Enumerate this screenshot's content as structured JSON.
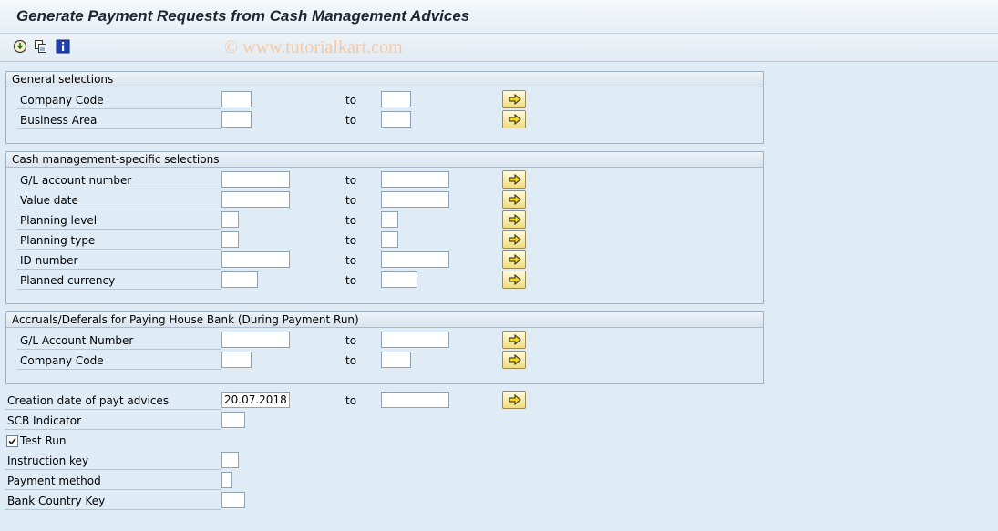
{
  "header": {
    "title": "Generate Payment Requests from Cash Management Advices"
  },
  "toolbar": {
    "execute_icon": "execute-icon",
    "variant_icon": "get-variant-icon",
    "info_icon": "info-icon",
    "watermark": "© www.tutorialkart.com"
  },
  "to_label": "to",
  "general": {
    "title": "General selections",
    "rows": [
      {
        "label": "Company Code",
        "from": "",
        "to": ""
      },
      {
        "label": "Business Area",
        "from": "",
        "to": ""
      }
    ]
  },
  "cash": {
    "title": "Cash management-specific selections",
    "rows": [
      {
        "label": "G/L account number",
        "from": "",
        "to": ""
      },
      {
        "label": "Value date",
        "from": "",
        "to": ""
      },
      {
        "label": "Planning level",
        "from": "",
        "to": ""
      },
      {
        "label": "Planning type",
        "from": "",
        "to": ""
      },
      {
        "label": "ID number",
        "from": "",
        "to": ""
      },
      {
        "label": "Planned currency",
        "from": "",
        "to": ""
      }
    ]
  },
  "accruals": {
    "title": "Accruals/Deferals for Paying House Bank (During Payment Run)",
    "rows": [
      {
        "label": "G/L Account Number",
        "from": "",
        "to": ""
      },
      {
        "label": "Company Code",
        "from": "",
        "to": ""
      }
    ]
  },
  "params": {
    "creation_date": {
      "label": "Creation date of payt advices",
      "from": "20.07.2018",
      "to": ""
    },
    "scb_indicator": {
      "label": "SCB Indicator",
      "value": ""
    },
    "test_run": {
      "label": "Test Run",
      "checked": true
    },
    "instruction_key": {
      "label": "Instruction key",
      "value": ""
    },
    "payment_method": {
      "label": "Payment method",
      "value": ""
    },
    "bank_country_key": {
      "label": "Bank Country Key",
      "value": ""
    }
  }
}
